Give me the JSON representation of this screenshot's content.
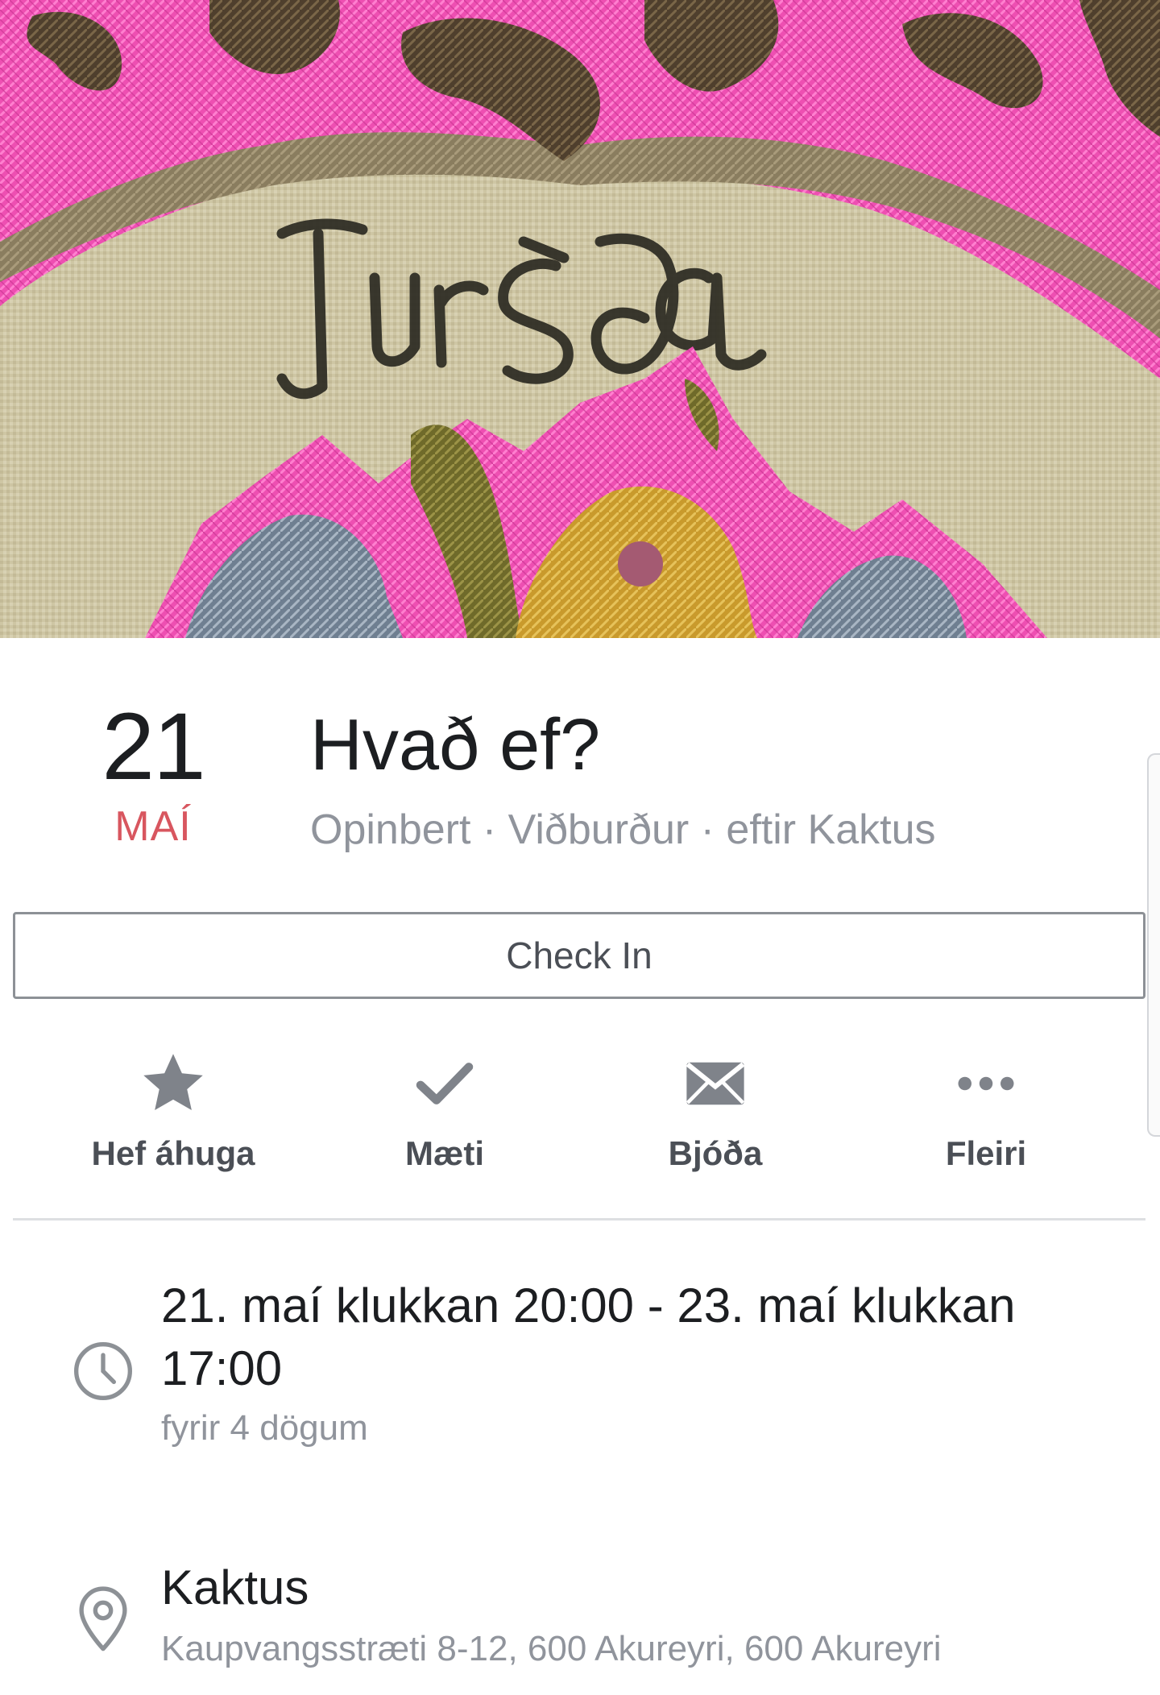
{
  "event": {
    "day": "21",
    "month": "MAÍ",
    "title": "Hvað ef?",
    "meta": "Opinbert · Viðburður · eftir Kaktus"
  },
  "checkin": {
    "label": "Check In"
  },
  "actions": [
    {
      "label": "Hef áhuga",
      "icon": "star-icon"
    },
    {
      "label": "Mæti",
      "icon": "check-icon"
    },
    {
      "label": "Bjóða",
      "icon": "envelope-icon"
    },
    {
      "label": "Fleiri",
      "icon": "more-icon"
    }
  ],
  "details": {
    "time": {
      "icon": "clock-icon",
      "main": "21. maí klukkan 20:00 - 23. maí klukkan 17:00",
      "sub": "fyrir 4 dögum"
    },
    "location": {
      "icon": "location-pin-icon",
      "main": "Kaktus",
      "sub": "Kaupvangsstræti 8-12, 600 Akureyri, 600 Akureyri"
    }
  },
  "colors": {
    "accent_date": "#d8565f",
    "text_primary": "#1c1e21",
    "text_secondary": "#90949c",
    "icon_gray": "#8d9196",
    "cover_pink": "#f04fb4",
    "cover_brown": "#4a3b2b",
    "cover_canvas": "#cfc7a6"
  }
}
